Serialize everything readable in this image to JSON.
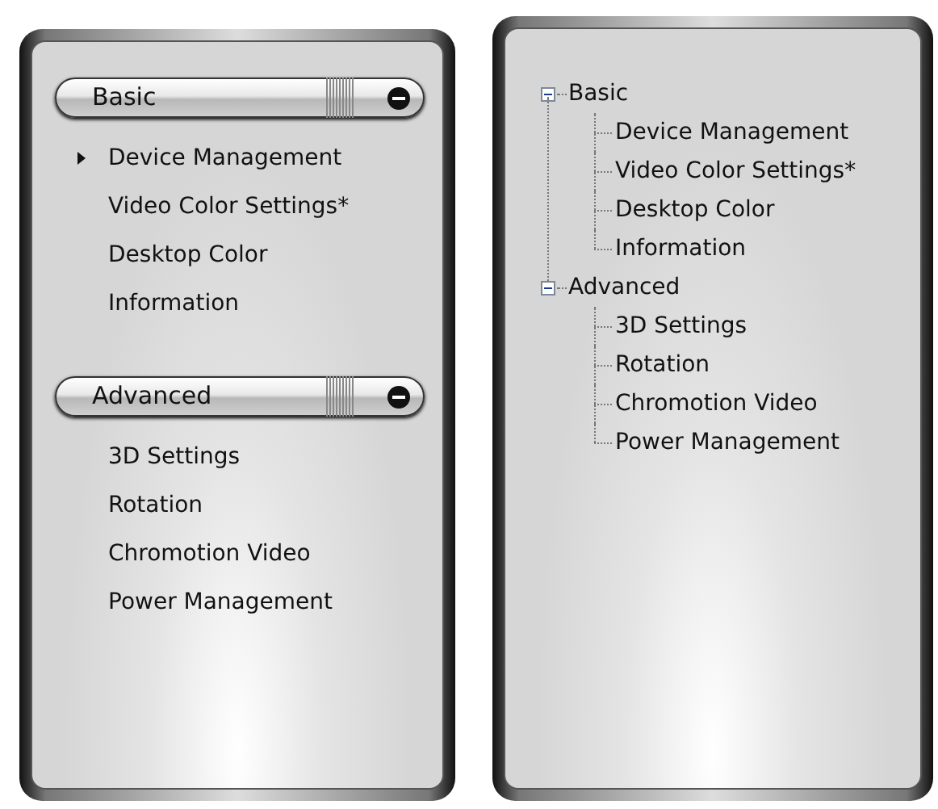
{
  "left_panel": {
    "sections": [
      {
        "title": "Basic",
        "expanded": true,
        "items": [
          {
            "label": "Device Management",
            "selected": true
          },
          {
            "label": "Video Color Settings*",
            "selected": false
          },
          {
            "label": "Desktop Color",
            "selected": false
          },
          {
            "label": "Information",
            "selected": false
          }
        ]
      },
      {
        "title": "Advanced",
        "expanded": true,
        "items": [
          {
            "label": "3D Settings",
            "selected": false
          },
          {
            "label": "Rotation",
            "selected": false
          },
          {
            "label": "Chromotion Video",
            "selected": false
          },
          {
            "label": "Power Management",
            "selected": false
          }
        ]
      }
    ]
  },
  "right_panel": {
    "tree": [
      {
        "label": "Basic",
        "expanded": true,
        "children": [
          {
            "label": "Device Management"
          },
          {
            "label": "Video Color Settings*"
          },
          {
            "label": "Desktop Color"
          },
          {
            "label": "Information"
          }
        ]
      },
      {
        "label": "Advanced",
        "expanded": true,
        "children": [
          {
            "label": "3D Settings"
          },
          {
            "label": "Rotation"
          },
          {
            "label": "Chromotion Video"
          },
          {
            "label": "Power Management"
          }
        ]
      }
    ]
  }
}
